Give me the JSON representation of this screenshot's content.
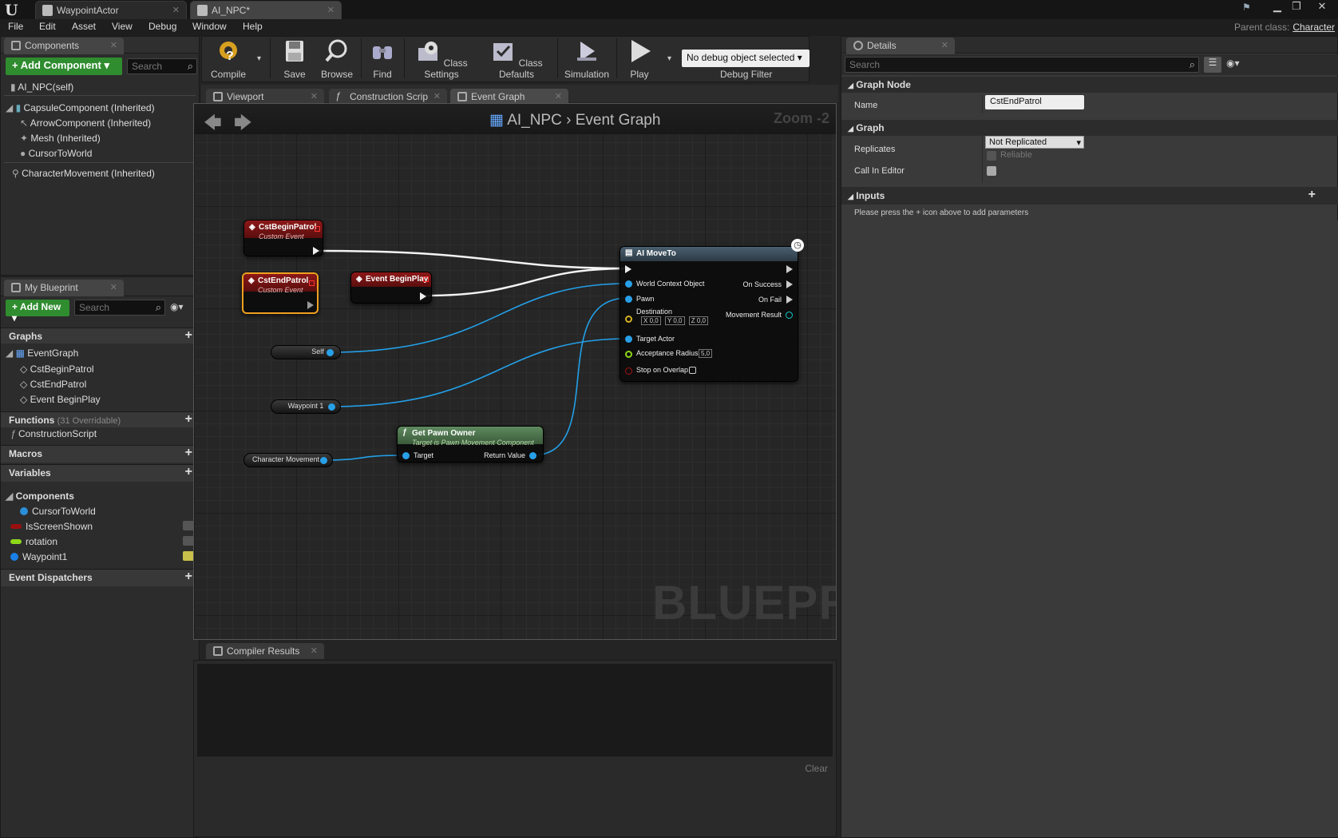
{
  "titlebar": {
    "logo": "U",
    "tabs": [
      {
        "label": "WaypointActor",
        "active": false
      },
      {
        "label": "AI_NPC*",
        "active": true
      }
    ],
    "parent_class_label": "Parent class:",
    "parent_class_value": "Character"
  },
  "menu": [
    "File",
    "Edit",
    "Asset",
    "View",
    "Debug",
    "Window",
    "Help"
  ],
  "components_panel": {
    "tab": "Components",
    "add_button": "+ Add Component",
    "search_placeholder": "Search",
    "self": "AI_NPC(self)",
    "items": [
      "CapsuleComponent (Inherited)",
      "ArrowComponent (Inherited)",
      "Mesh (Inherited)",
      "CursorToWorld",
      "CharacterMovement (Inherited)"
    ]
  },
  "my_blueprint": {
    "tab": "My Blueprint",
    "add_button": "+ Add New",
    "search_placeholder": "Search",
    "graphs_header": "Graphs",
    "graphs": [
      "EventGraph",
      "CstBeginPatrol",
      "CstEndPatrol",
      "Event BeginPlay"
    ],
    "functions_header": "Functions",
    "functions_sub": "(31 Overridable)",
    "functions": [
      "ConstructionScript"
    ],
    "macros_header": "Macros",
    "variables_header": "Variables",
    "components_header": "Components",
    "variables": [
      {
        "name": "CursorToWorld",
        "color": "#2a8fd8"
      },
      {
        "name": "IsScreenShown",
        "color": "#9a0f0f"
      },
      {
        "name": "rotation",
        "color": "#8fd81a"
      },
      {
        "name": "Waypoint1",
        "color": "#1a80e8"
      }
    ],
    "dispatchers_header": "Event Dispatchers"
  },
  "toolbar": {
    "buttons": [
      "Compile",
      "Save",
      "Browse",
      "Find",
      "Class Settings",
      "Class Defaults",
      "Simulation",
      "Play"
    ],
    "debug_select": "No debug object selected",
    "debug_filter": "Debug Filter"
  },
  "editor_tabs": [
    "Viewport",
    "Construction Scrip",
    "Event Graph"
  ],
  "graph": {
    "breadcrumb_root": "AI_NPC",
    "breadcrumb_leaf": "Event Graph",
    "zoom": "Zoom -2",
    "watermark": "BLUEPRINT",
    "nodes": {
      "begin_patrol": {
        "title": "CstBeginPatrol",
        "sub": "Custom Event"
      },
      "end_patrol": {
        "title": "CstEndPatrol",
        "sub": "Custom Event"
      },
      "begin_play": {
        "title": "Event BeginPlay"
      },
      "self": "Self",
      "waypoint": "Waypoint 1",
      "char_movement": "Character Movement",
      "pawn_owner": {
        "title": "Get Pawn Owner",
        "sub": "Target is Pawn Movement Component",
        "in": "Target",
        "out": "Return Value"
      },
      "ai_moveto": {
        "title": "AI MoveTo",
        "inputs": [
          "World Context Object",
          "Pawn",
          "Destination",
          "Target Actor",
          "Acceptance Radius",
          "Stop on Overlap"
        ],
        "outputs": [
          "On Success",
          "On Fail",
          "Movement Result"
        ],
        "dest_x": "0,0",
        "dest_y": "0,0",
        "dest_z": "0,0",
        "radius": "5,0",
        "axis_x": "X",
        "axis_y": "Y",
        "axis_z": "Z"
      }
    }
  },
  "compiler": {
    "tab": "Compiler Results",
    "clear": "Clear"
  },
  "details": {
    "tab": "Details",
    "search_placeholder": "Search",
    "graph_node_header": "Graph Node",
    "name_label": "Name",
    "name_value": "CstEndPatrol",
    "graph_header": "Graph",
    "replicates_label": "Replicates",
    "replicates_value": "Not Replicated",
    "reliable_label": "Reliable",
    "call_in_editor_label": "Call In Editor",
    "inputs_header": "Inputs",
    "inputs_hint": "Please press the + icon above to add parameters"
  }
}
